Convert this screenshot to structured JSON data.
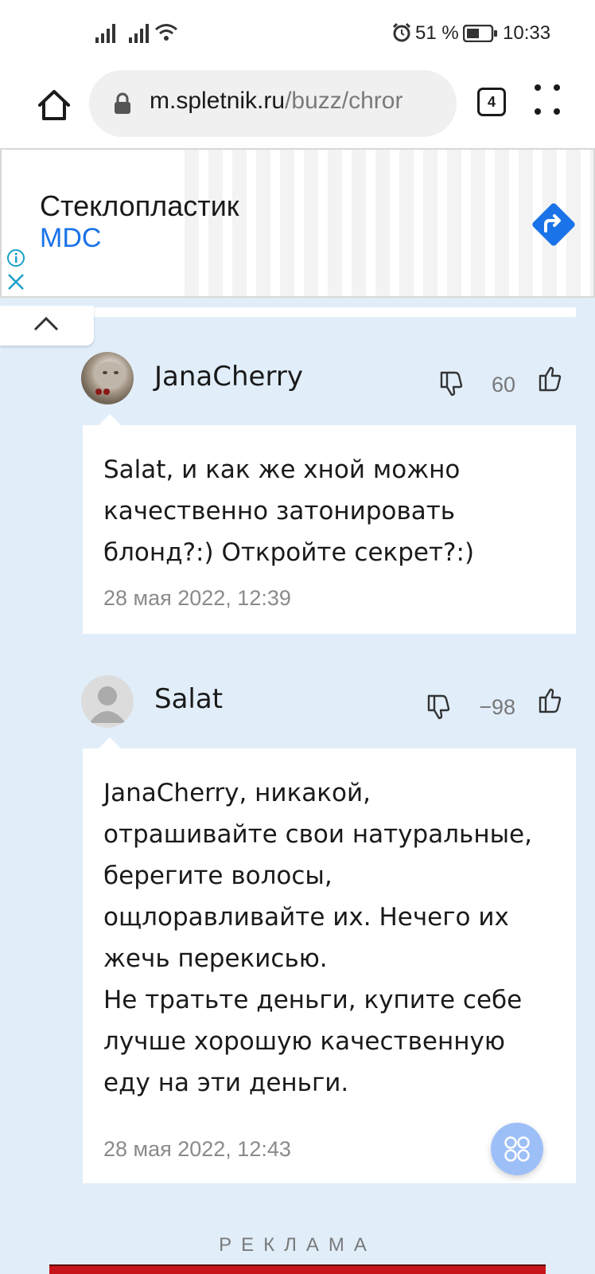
{
  "status_bar": {
    "battery": "51 %",
    "time": "10:33"
  },
  "browser": {
    "url_host": "m.spletnik.ru",
    "url_path": "/buzz/chror",
    "tab_count": "4"
  },
  "ad": {
    "title": "Стеклопластик",
    "brand": "MDC",
    "accent": "#1a73e8"
  },
  "comments": [
    {
      "author": "JanaCherry",
      "score": "60",
      "text": "Salat, и как же хной можно\nкачественно затонировать\nблонд?:) Откройте секрет?:)",
      "date": "28 мая 2022, 12:39"
    },
    {
      "author": "Salat",
      "score": "−98",
      "text": "JanaCherry, никакой,\nотрашивайте свои натуральные,\nберегите волосы,\nощлоравливайте их. Нечего их\nжечь перекисью.\nНе тратьте деньги, купите себе\nлучше хорошую качественную\nеду на эти деньги.",
      "date": "28 мая 2022, 12:43"
    }
  ],
  "footer": {
    "ad_label": "РЕКЛАМА"
  }
}
